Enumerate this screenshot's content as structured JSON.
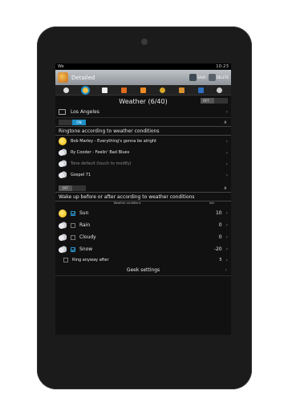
{
  "status": {
    "left": "We",
    "time": "10:23"
  },
  "actionbar": {
    "title": "Detailed",
    "save": "SAVE",
    "delete": "DELETE"
  },
  "header": {
    "title": "Weather (6/40)",
    "toggle": "OFF"
  },
  "location": {
    "label": "Los Angeles"
  },
  "ringtone_section": {
    "toggle": "ON",
    "title": "Ringtone according to weather conditions",
    "items": [
      {
        "icon": "sun-icon",
        "label": "Bob Marley - Everything's gonna be alright",
        "dim": false
      },
      {
        "icon": "rain-icon",
        "label": "Ry Cooder - Feelin' Bad Blues",
        "dim": false
      },
      {
        "icon": "cloud-icon",
        "label": "Tone default (touch to modify)",
        "dim": true
      },
      {
        "icon": "snow-icon",
        "label": "Gospel 71",
        "dim": false
      }
    ]
  },
  "wake_section": {
    "toggle": "OFF",
    "title": "Wake up before or after according to weather conditions",
    "col_conditions": "Weather conditions",
    "col_min": "min",
    "items": [
      {
        "icon": "sun-icon",
        "label": "Sun",
        "checked": true,
        "value": "10"
      },
      {
        "icon": "rain-icon",
        "label": "Rain",
        "checked": false,
        "value": "0"
      },
      {
        "icon": "cloud-icon",
        "label": "Cloudy",
        "checked": false,
        "value": "0"
      },
      {
        "icon": "snow-icon",
        "label": "Snow",
        "checked": true,
        "value": "-20"
      }
    ],
    "ring_anyway": {
      "label": "Ring anyway after",
      "value": "5"
    }
  },
  "geek": {
    "label": "Geek settings"
  }
}
